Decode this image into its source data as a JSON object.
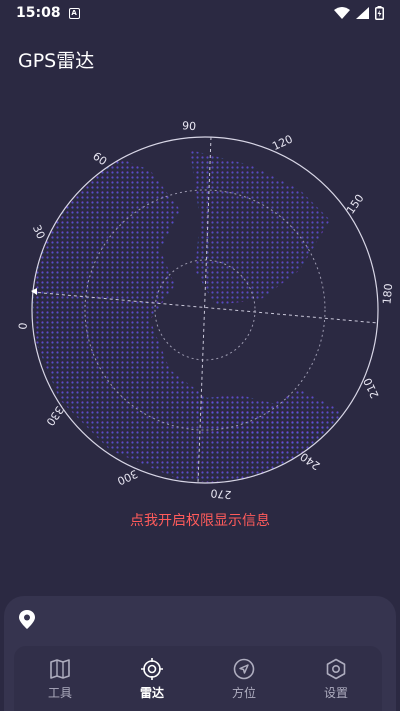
{
  "status": {
    "time": "15:08",
    "notify_badge": "A"
  },
  "page": {
    "title": "GPS雷达"
  },
  "radar": {
    "ticks": [
      {
        "label": "90",
        "angle": 90
      },
      {
        "label": "60",
        "angle": 60
      },
      {
        "label": "30",
        "angle": 30
      },
      {
        "label": "0",
        "angle": 0
      },
      {
        "label": "330",
        "angle": 330
      },
      {
        "label": "300",
        "angle": 300
      },
      {
        "label": "270",
        "angle": 270
      },
      {
        "label": "240",
        "angle": 240
      },
      {
        "label": "210",
        "angle": 210
      },
      {
        "label": "180",
        "angle": 180
      },
      {
        "label": "150",
        "angle": 150
      },
      {
        "label": "120",
        "angle": 120
      }
    ]
  },
  "permission": {
    "text": "点我开启权限显示信息"
  },
  "location": {
    "icon": "location-pin-icon"
  },
  "nav": {
    "items": [
      {
        "label": "工具",
        "icon": "map-icon",
        "active": false
      },
      {
        "label": "雷达",
        "icon": "radar-icon",
        "active": true
      },
      {
        "label": "方位",
        "icon": "compass-arrow-icon",
        "active": false
      },
      {
        "label": "设置",
        "icon": "settings-hexagon-icon",
        "active": false
      }
    ]
  },
  "colors": {
    "background": "#2b2942",
    "accent_red": "#ff5b5b",
    "dots_purple": "#9b3de0",
    "dots_blue": "#3a6fd0",
    "dots_cyan": "#2fb8c8"
  }
}
